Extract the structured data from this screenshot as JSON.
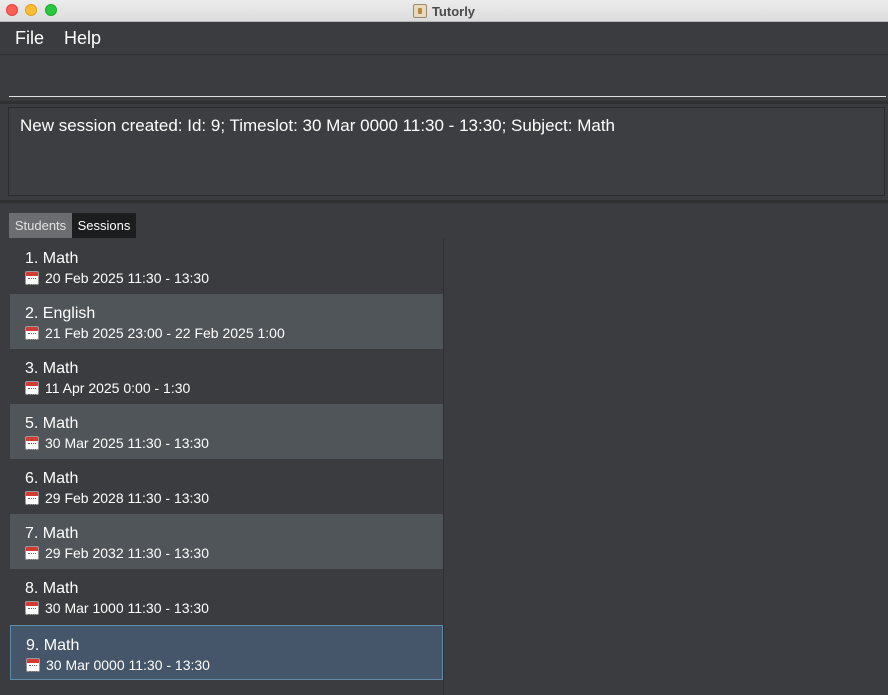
{
  "window": {
    "title": "Tutorly"
  },
  "menu": {
    "file": "File",
    "help": "Help"
  },
  "command": {
    "value": "",
    "placeholder": ""
  },
  "result": {
    "text": "New session created: Id: 9; Timeslot: 30 Mar 0000 11:30 - 13:30; Subject: Math"
  },
  "tabs": {
    "students": "Students",
    "sessions": "Sessions",
    "active": "Sessions"
  },
  "sessions": [
    {
      "title": "1. Math",
      "time": "20 Feb 2025 11:30 - 13:30"
    },
    {
      "title": "2. English",
      "time": "21 Feb 2025 23:00 - 22 Feb 2025 1:00"
    },
    {
      "title": "3. Math",
      "time": "11 Apr 2025 0:00 - 1:30"
    },
    {
      "title": "5. Math",
      "time": "30 Mar 2025 11:30 - 13:30"
    },
    {
      "title": "6. Math",
      "time": "29 Feb 2028 11:30 - 13:30"
    },
    {
      "title": "7. Math",
      "time": "29 Feb 2032 11:30 - 13:30"
    },
    {
      "title": "8. Math",
      "time": "30 Mar 1000 11:30 - 13:30"
    },
    {
      "title": "9. Math",
      "time": "30 Mar 0000 11:30 - 13:30"
    }
  ],
  "selected_session": "9. Math",
  "icons": {
    "session_time": "calendar-icon"
  },
  "colors": {
    "accent": "#5f8aa8",
    "selected_bg": "#45556a",
    "alt_row": "#4f5558"
  }
}
